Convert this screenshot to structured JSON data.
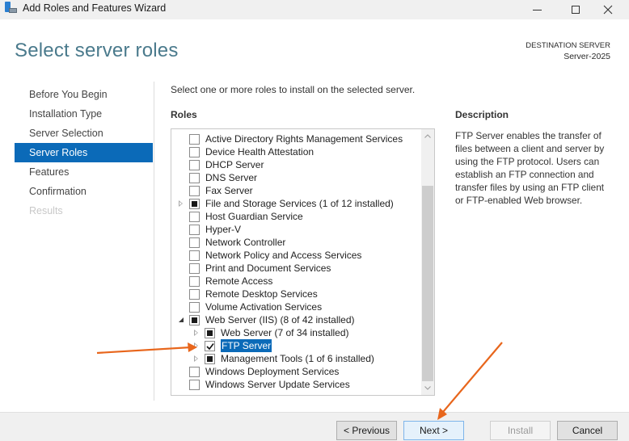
{
  "window": {
    "title": "Add Roles and Features Wizard",
    "icon": "server-manager-icon",
    "controls": [
      "minimize-icon",
      "maximize-icon",
      "close-icon"
    ]
  },
  "header": {
    "page_title": "Select server roles",
    "destination_label": "DESTINATION SERVER",
    "destination_server": "Server-2025"
  },
  "nav": {
    "items": [
      {
        "label": "Before You Begin",
        "state": "normal"
      },
      {
        "label": "Installation Type",
        "state": "normal"
      },
      {
        "label": "Server Selection",
        "state": "normal"
      },
      {
        "label": "Server Roles",
        "state": "active"
      },
      {
        "label": "Features",
        "state": "normal"
      },
      {
        "label": "Confirmation",
        "state": "normal"
      },
      {
        "label": "Results",
        "state": "disabled"
      }
    ]
  },
  "main": {
    "instruction": "Select one or more roles to install on the selected server.",
    "roles_heading": "Roles",
    "roles": [
      {
        "label": "Active Directory Rights Management Services",
        "state": "unchecked",
        "level": 0,
        "expander": "none"
      },
      {
        "label": "Device Health Attestation",
        "state": "unchecked",
        "level": 0,
        "expander": "none"
      },
      {
        "label": "DHCP Server",
        "state": "unchecked",
        "level": 0,
        "expander": "none"
      },
      {
        "label": "DNS Server",
        "state": "unchecked",
        "level": 0,
        "expander": "none"
      },
      {
        "label": "Fax Server",
        "state": "unchecked",
        "level": 0,
        "expander": "none"
      },
      {
        "label": "File and Storage Services (1 of 12 installed)",
        "state": "partial",
        "level": 0,
        "expander": "collapsed"
      },
      {
        "label": "Host Guardian Service",
        "state": "unchecked",
        "level": 0,
        "expander": "none"
      },
      {
        "label": "Hyper-V",
        "state": "unchecked",
        "level": 0,
        "expander": "none"
      },
      {
        "label": "Network Controller",
        "state": "unchecked",
        "level": 0,
        "expander": "none"
      },
      {
        "label": "Network Policy and Access Services",
        "state": "unchecked",
        "level": 0,
        "expander": "none"
      },
      {
        "label": "Print and Document Services",
        "state": "unchecked",
        "level": 0,
        "expander": "none"
      },
      {
        "label": "Remote Access",
        "state": "unchecked",
        "level": 0,
        "expander": "none"
      },
      {
        "label": "Remote Desktop Services",
        "state": "unchecked",
        "level": 0,
        "expander": "none"
      },
      {
        "label": "Volume Activation Services",
        "state": "unchecked",
        "level": 0,
        "expander": "none"
      },
      {
        "label": "Web Server (IIS) (8 of 42 installed)",
        "state": "partial",
        "level": 0,
        "expander": "expanded"
      },
      {
        "label": "Web Server (7 of 34 installed)",
        "state": "partial",
        "level": 1,
        "expander": "collapsed"
      },
      {
        "label": "FTP Server",
        "state": "checked",
        "level": 1,
        "expander": "collapsed",
        "selected": true
      },
      {
        "label": "Management Tools (1 of 6 installed)",
        "state": "partial",
        "level": 1,
        "expander": "collapsed"
      },
      {
        "label": "Windows Deployment Services",
        "state": "unchecked",
        "level": 0,
        "expander": "none"
      },
      {
        "label": "Windows Server Update Services",
        "state": "unchecked",
        "level": 0,
        "expander": "none"
      }
    ],
    "scrollbar": {
      "position_fraction": 1.0,
      "visible_fraction": 0.82
    }
  },
  "description": {
    "heading": "Description",
    "text": "FTP Server enables the transfer of files between a client and server by using the FTP protocol. Users can establish an FTP connection and transfer files by using an FTP client or FTP-enabled Web browser."
  },
  "footer": {
    "previous_label": "< Previous",
    "next_label": "Next >",
    "install_label": "Install",
    "cancel_label": "Cancel"
  },
  "annotations": {
    "arrow_color": "#e8661c",
    "arrows": [
      "points-to-ftp-server",
      "points-to-next-button"
    ]
  }
}
